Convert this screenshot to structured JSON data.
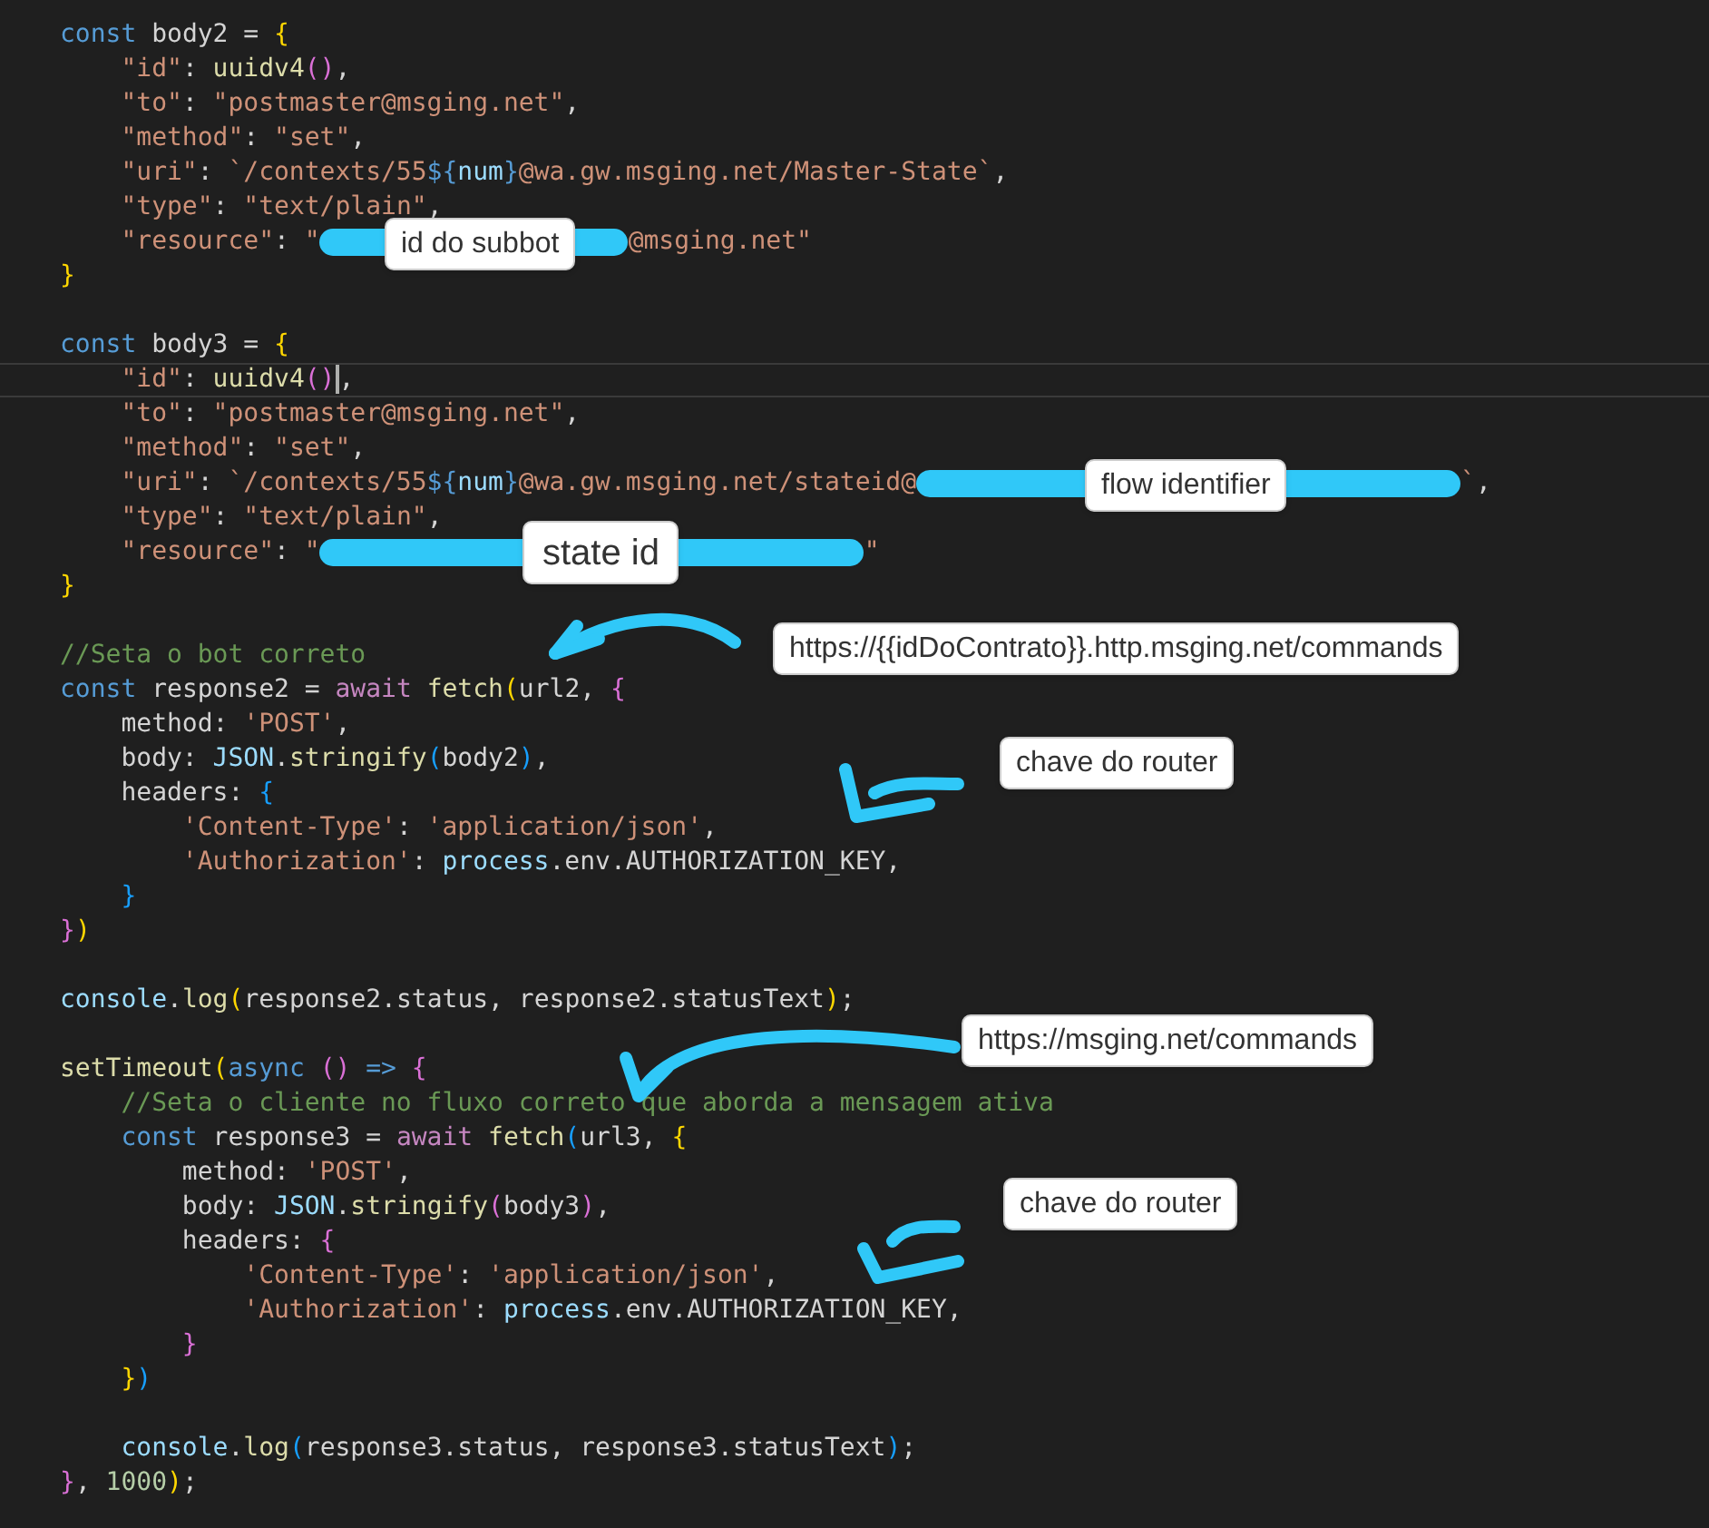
{
  "editor": {
    "lines": [
      {
        "kind": "code",
        "current": false,
        "tokens": [
          {
            "kind": "kw",
            "text": "const"
          },
          {
            "kind": "plain",
            "text": " body2 = "
          },
          {
            "kind": "b1",
            "text": "{"
          }
        ]
      },
      {
        "kind": "code",
        "current": false,
        "tokens": [
          {
            "kind": "str",
            "text": "    \"id\""
          },
          {
            "kind": "plain",
            "text": ": "
          },
          {
            "kind": "fn",
            "text": "uuidv4"
          },
          {
            "kind": "b2",
            "text": "()"
          },
          {
            "kind": "plain",
            "text": ","
          }
        ]
      },
      {
        "kind": "code",
        "current": false,
        "tokens": [
          {
            "kind": "str",
            "text": "    \"to\""
          },
          {
            "kind": "plain",
            "text": ": "
          },
          {
            "kind": "str",
            "text": "\"postmaster@msging.net\""
          },
          {
            "kind": "plain",
            "text": ","
          }
        ]
      },
      {
        "kind": "code",
        "current": false,
        "tokens": [
          {
            "kind": "str",
            "text": "    \"method\""
          },
          {
            "kind": "plain",
            "text": ": "
          },
          {
            "kind": "str",
            "text": "\"set\""
          },
          {
            "kind": "plain",
            "text": ","
          }
        ]
      },
      {
        "kind": "code",
        "current": false,
        "tokens": [
          {
            "kind": "str",
            "text": "    \"uri\""
          },
          {
            "kind": "plain",
            "text": ": "
          },
          {
            "kind": "str",
            "text": "`/contexts/55"
          },
          {
            "kind": "kw",
            "text": "${"
          },
          {
            "kind": "var",
            "text": "num"
          },
          {
            "kind": "kw",
            "text": "}"
          },
          {
            "kind": "str",
            "text": "@wa.gw.msging.net/Master-State`"
          },
          {
            "kind": "plain",
            "text": ","
          }
        ]
      },
      {
        "kind": "code",
        "current": false,
        "tokens": [
          {
            "kind": "str",
            "text": "    \"type\""
          },
          {
            "kind": "plain",
            "text": ": "
          },
          {
            "kind": "str",
            "text": "\"text/plain\""
          },
          {
            "kind": "plain",
            "text": ","
          }
        ]
      },
      {
        "kind": "code",
        "current": false,
        "tokens": [
          {
            "kind": "str",
            "text": "    \"resource\""
          },
          {
            "kind": "plain",
            "text": ": "
          },
          {
            "kind": "str",
            "text": "\""
          },
          {
            "kind": "redacted"
          },
          {
            "kind": "str",
            "text": "@msging.net\""
          }
        ]
      },
      {
        "kind": "code",
        "current": false,
        "tokens": [
          {
            "kind": "b1",
            "text": "}"
          }
        ]
      },
      {
        "kind": "blank"
      },
      {
        "kind": "code",
        "current": false,
        "tokens": [
          {
            "kind": "kw",
            "text": "const"
          },
          {
            "kind": "plain",
            "text": " body3 = "
          },
          {
            "kind": "b1",
            "text": "{"
          }
        ]
      },
      {
        "kind": "code",
        "current": true,
        "tokens": [
          {
            "kind": "str",
            "text": "    \"id\""
          },
          {
            "kind": "plain",
            "text": ": "
          },
          {
            "kind": "fn",
            "text": "uuidv4"
          },
          {
            "kind": "b2",
            "text": "()"
          },
          {
            "kind": "plain",
            "text": ","
          }
        ]
      },
      {
        "kind": "code",
        "current": false,
        "tokens": [
          {
            "kind": "str",
            "text": "    \"to\""
          },
          {
            "kind": "plain",
            "text": ": "
          },
          {
            "kind": "str",
            "text": "\"postmaster@msging.net\""
          },
          {
            "kind": "plain",
            "text": ","
          }
        ]
      },
      {
        "kind": "code",
        "current": false,
        "tokens": [
          {
            "kind": "str",
            "text": "    \"method\""
          },
          {
            "kind": "plain",
            "text": ": "
          },
          {
            "kind": "str",
            "text": "\"set\""
          },
          {
            "kind": "plain",
            "text": ","
          }
        ]
      },
      {
        "kind": "code",
        "current": false,
        "tokens": [
          {
            "kind": "str",
            "text": "    \"uri\""
          },
          {
            "kind": "plain",
            "text": ": "
          },
          {
            "kind": "str",
            "text": "`/contexts/55"
          },
          {
            "kind": "kw",
            "text": "${"
          },
          {
            "kind": "var",
            "text": "num"
          },
          {
            "kind": "kw",
            "text": "}"
          },
          {
            "kind": "str",
            "text": "@wa.gw.msging.net/stateid@"
          },
          {
            "kind": "redacted"
          },
          {
            "kind": "str",
            "text": "`"
          },
          {
            "kind": "plain",
            "text": ","
          }
        ]
      },
      {
        "kind": "code",
        "current": false,
        "tokens": [
          {
            "kind": "str",
            "text": "    \"type\""
          },
          {
            "kind": "plain",
            "text": ": "
          },
          {
            "kind": "str",
            "text": "\"text/plain\""
          },
          {
            "kind": "plain",
            "text": ","
          }
        ]
      },
      {
        "kind": "code",
        "current": false,
        "tokens": [
          {
            "kind": "str",
            "text": "    \"resource\""
          },
          {
            "kind": "plain",
            "text": ": "
          },
          {
            "kind": "str",
            "text": "\""
          },
          {
            "kind": "redacted"
          },
          {
            "kind": "str",
            "text": "\""
          }
        ]
      },
      {
        "kind": "code",
        "current": false,
        "tokens": [
          {
            "kind": "b1",
            "text": "}"
          }
        ]
      },
      {
        "kind": "blank"
      },
      {
        "kind": "code",
        "current": false,
        "tokens": [
          {
            "kind": "cmt",
            "text": "//Seta o bot correto"
          }
        ]
      },
      {
        "kind": "code",
        "current": false,
        "tokens": [
          {
            "kind": "kw",
            "text": "const"
          },
          {
            "kind": "plain",
            "text": " response2 = "
          },
          {
            "kind": "ctl",
            "text": "await "
          },
          {
            "kind": "fn",
            "text": "fetch"
          },
          {
            "kind": "b1",
            "text": "("
          },
          {
            "kind": "plain",
            "text": "url2, "
          },
          {
            "kind": "b2",
            "text": "{"
          }
        ]
      },
      {
        "kind": "code",
        "current": false,
        "tokens": [
          {
            "kind": "plain",
            "text": "    method: "
          },
          {
            "kind": "str",
            "text": "'POST'"
          },
          {
            "kind": "plain",
            "text": ","
          }
        ]
      },
      {
        "kind": "code",
        "current": false,
        "tokens": [
          {
            "kind": "plain",
            "text": "    body: "
          },
          {
            "kind": "var",
            "text": "JSON"
          },
          {
            "kind": "plain",
            "text": "."
          },
          {
            "kind": "fn",
            "text": "stringify"
          },
          {
            "kind": "b3",
            "text": "("
          },
          {
            "kind": "plain",
            "text": "body2"
          },
          {
            "kind": "b3",
            "text": ")"
          },
          {
            "kind": "plain",
            "text": ","
          }
        ]
      },
      {
        "kind": "code",
        "current": false,
        "tokens": [
          {
            "kind": "plain",
            "text": "    headers: "
          },
          {
            "kind": "b3",
            "text": "{"
          }
        ]
      },
      {
        "kind": "code",
        "current": false,
        "tokens": [
          {
            "kind": "str",
            "text": "        'Content-Type'"
          },
          {
            "kind": "plain",
            "text": ": "
          },
          {
            "kind": "str",
            "text": "'application/json'"
          },
          {
            "kind": "plain",
            "text": ","
          }
        ]
      },
      {
        "kind": "code",
        "current": false,
        "tokens": [
          {
            "kind": "str",
            "text": "        'Authorization'"
          },
          {
            "kind": "plain",
            "text": ": "
          },
          {
            "kind": "var",
            "text": "process"
          },
          {
            "kind": "plain",
            "text": ".env.AUTHORIZATION_KEY,"
          }
        ]
      },
      {
        "kind": "code",
        "current": false,
        "tokens": [
          {
            "kind": "b3",
            "text": "    }"
          }
        ]
      },
      {
        "kind": "code",
        "current": false,
        "tokens": [
          {
            "kind": "b2",
            "text": "}"
          },
          {
            "kind": "b1",
            "text": ")"
          }
        ]
      },
      {
        "kind": "blank"
      },
      {
        "kind": "code",
        "current": false,
        "tokens": [
          {
            "kind": "var",
            "text": "console"
          },
          {
            "kind": "plain",
            "text": "."
          },
          {
            "kind": "fn",
            "text": "log"
          },
          {
            "kind": "b1",
            "text": "("
          },
          {
            "kind": "plain",
            "text": "response2.status, response2.statusText"
          },
          {
            "kind": "b1",
            "text": ")"
          },
          {
            "kind": "plain",
            "text": ";"
          }
        ]
      },
      {
        "kind": "blank"
      },
      {
        "kind": "code",
        "current": false,
        "tokens": [
          {
            "kind": "fn",
            "text": "setTimeout"
          },
          {
            "kind": "b1",
            "text": "("
          },
          {
            "kind": "kw",
            "text": "async "
          },
          {
            "kind": "b2",
            "text": "()"
          },
          {
            "kind": "kw",
            "text": " => "
          },
          {
            "kind": "b2",
            "text": "{"
          }
        ]
      },
      {
        "kind": "code",
        "current": false,
        "tokens": [
          {
            "kind": "cmt",
            "text": "    //Seta o cliente no fluxo correto que aborda a mensagem ativa"
          }
        ]
      },
      {
        "kind": "code",
        "current": false,
        "tokens": [
          {
            "kind": "kw",
            "text": "    const"
          },
          {
            "kind": "plain",
            "text": " response3 = "
          },
          {
            "kind": "ctl",
            "text": "await "
          },
          {
            "kind": "fn",
            "text": "fetch"
          },
          {
            "kind": "b3",
            "text": "("
          },
          {
            "kind": "plain",
            "text": "url3, "
          },
          {
            "kind": "b1",
            "text": "{"
          }
        ]
      },
      {
        "kind": "code",
        "current": false,
        "tokens": [
          {
            "kind": "plain",
            "text": "        method: "
          },
          {
            "kind": "str",
            "text": "'POST'"
          },
          {
            "kind": "plain",
            "text": ","
          }
        ]
      },
      {
        "kind": "code",
        "current": false,
        "tokens": [
          {
            "kind": "plain",
            "text": "        body: "
          },
          {
            "kind": "var",
            "text": "JSON"
          },
          {
            "kind": "plain",
            "text": "."
          },
          {
            "kind": "fn",
            "text": "stringify"
          },
          {
            "kind": "b2",
            "text": "("
          },
          {
            "kind": "plain",
            "text": "body3"
          },
          {
            "kind": "b2",
            "text": ")"
          },
          {
            "kind": "plain",
            "text": ","
          }
        ]
      },
      {
        "kind": "code",
        "current": false,
        "tokens": [
          {
            "kind": "plain",
            "text": "        headers: "
          },
          {
            "kind": "b2",
            "text": "{"
          }
        ]
      },
      {
        "kind": "code",
        "current": false,
        "tokens": [
          {
            "kind": "str",
            "text": "            'Content-Type'"
          },
          {
            "kind": "plain",
            "text": ": "
          },
          {
            "kind": "str",
            "text": "'application/json'"
          },
          {
            "kind": "plain",
            "text": ","
          }
        ]
      },
      {
        "kind": "code",
        "current": false,
        "tokens": [
          {
            "kind": "str",
            "text": "            'Authorization'"
          },
          {
            "kind": "plain",
            "text": ": "
          },
          {
            "kind": "var",
            "text": "process"
          },
          {
            "kind": "plain",
            "text": ".env.AUTHORIZATION_KEY,"
          }
        ]
      },
      {
        "kind": "code",
        "current": false,
        "tokens": [
          {
            "kind": "b2",
            "text": "        }"
          }
        ]
      },
      {
        "kind": "code",
        "current": false,
        "tokens": [
          {
            "kind": "b1",
            "text": "    }"
          },
          {
            "kind": "b3",
            "text": ")"
          }
        ]
      },
      {
        "kind": "blank"
      },
      {
        "kind": "code",
        "current": false,
        "tokens": [
          {
            "kind": "var",
            "text": "    console"
          },
          {
            "kind": "plain",
            "text": "."
          },
          {
            "kind": "fn",
            "text": "log"
          },
          {
            "kind": "b3",
            "text": "("
          },
          {
            "kind": "plain",
            "text": "response3.status, response3.statusText"
          },
          {
            "kind": "b3",
            "text": ")"
          },
          {
            "kind": "plain",
            "text": ";"
          }
        ]
      },
      {
        "kind": "code",
        "current": false,
        "tokens": [
          {
            "kind": "b2",
            "text": "}"
          },
          {
            "kind": "plain",
            "text": ", "
          },
          {
            "kind": "num",
            "text": "1000"
          },
          {
            "kind": "b1",
            "text": ")"
          },
          {
            "kind": "plain",
            "text": ";"
          }
        ]
      }
    ]
  },
  "annotations": [
    {
      "text": "id do subbot"
    },
    {
      "text": "flow identifier"
    },
    {
      "text": "state id"
    },
    {
      "text": "https://{{idDoContrato}}.http.msging.net/commands"
    },
    {
      "text": "chave do router"
    },
    {
      "text": "https://msging.net/commands"
    },
    {
      "text": "chave do router"
    }
  ]
}
